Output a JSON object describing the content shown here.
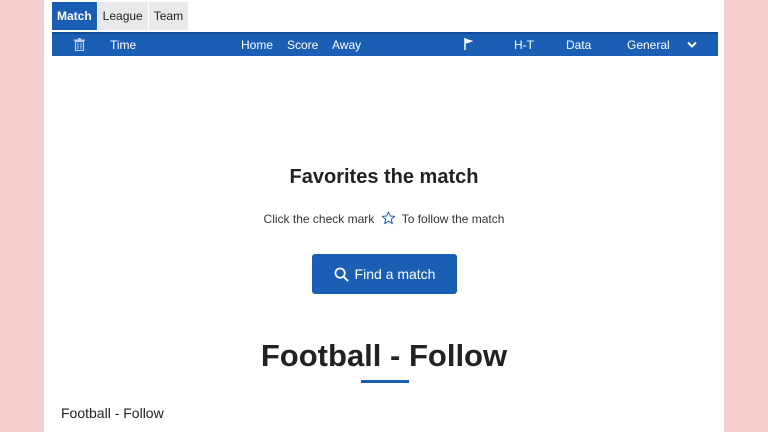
{
  "tabs": [
    {
      "label": "Match"
    },
    {
      "label": "League"
    },
    {
      "label": "Team"
    }
  ],
  "header": {
    "time": "Time",
    "home": "Home",
    "score": "Score",
    "away": "Away",
    "ht": "H-T",
    "data": "Data",
    "general": "General"
  },
  "favorites": {
    "title": "Favorites the match",
    "hint_before": "Click the check mark",
    "hint_after": "To follow the match",
    "button_label": "Find a match"
  },
  "section": {
    "title": "Football - Follow",
    "text": "Football - Follow"
  },
  "colors": {
    "accent": "#1a5fb4",
    "side_background": "#f6cdcf"
  }
}
